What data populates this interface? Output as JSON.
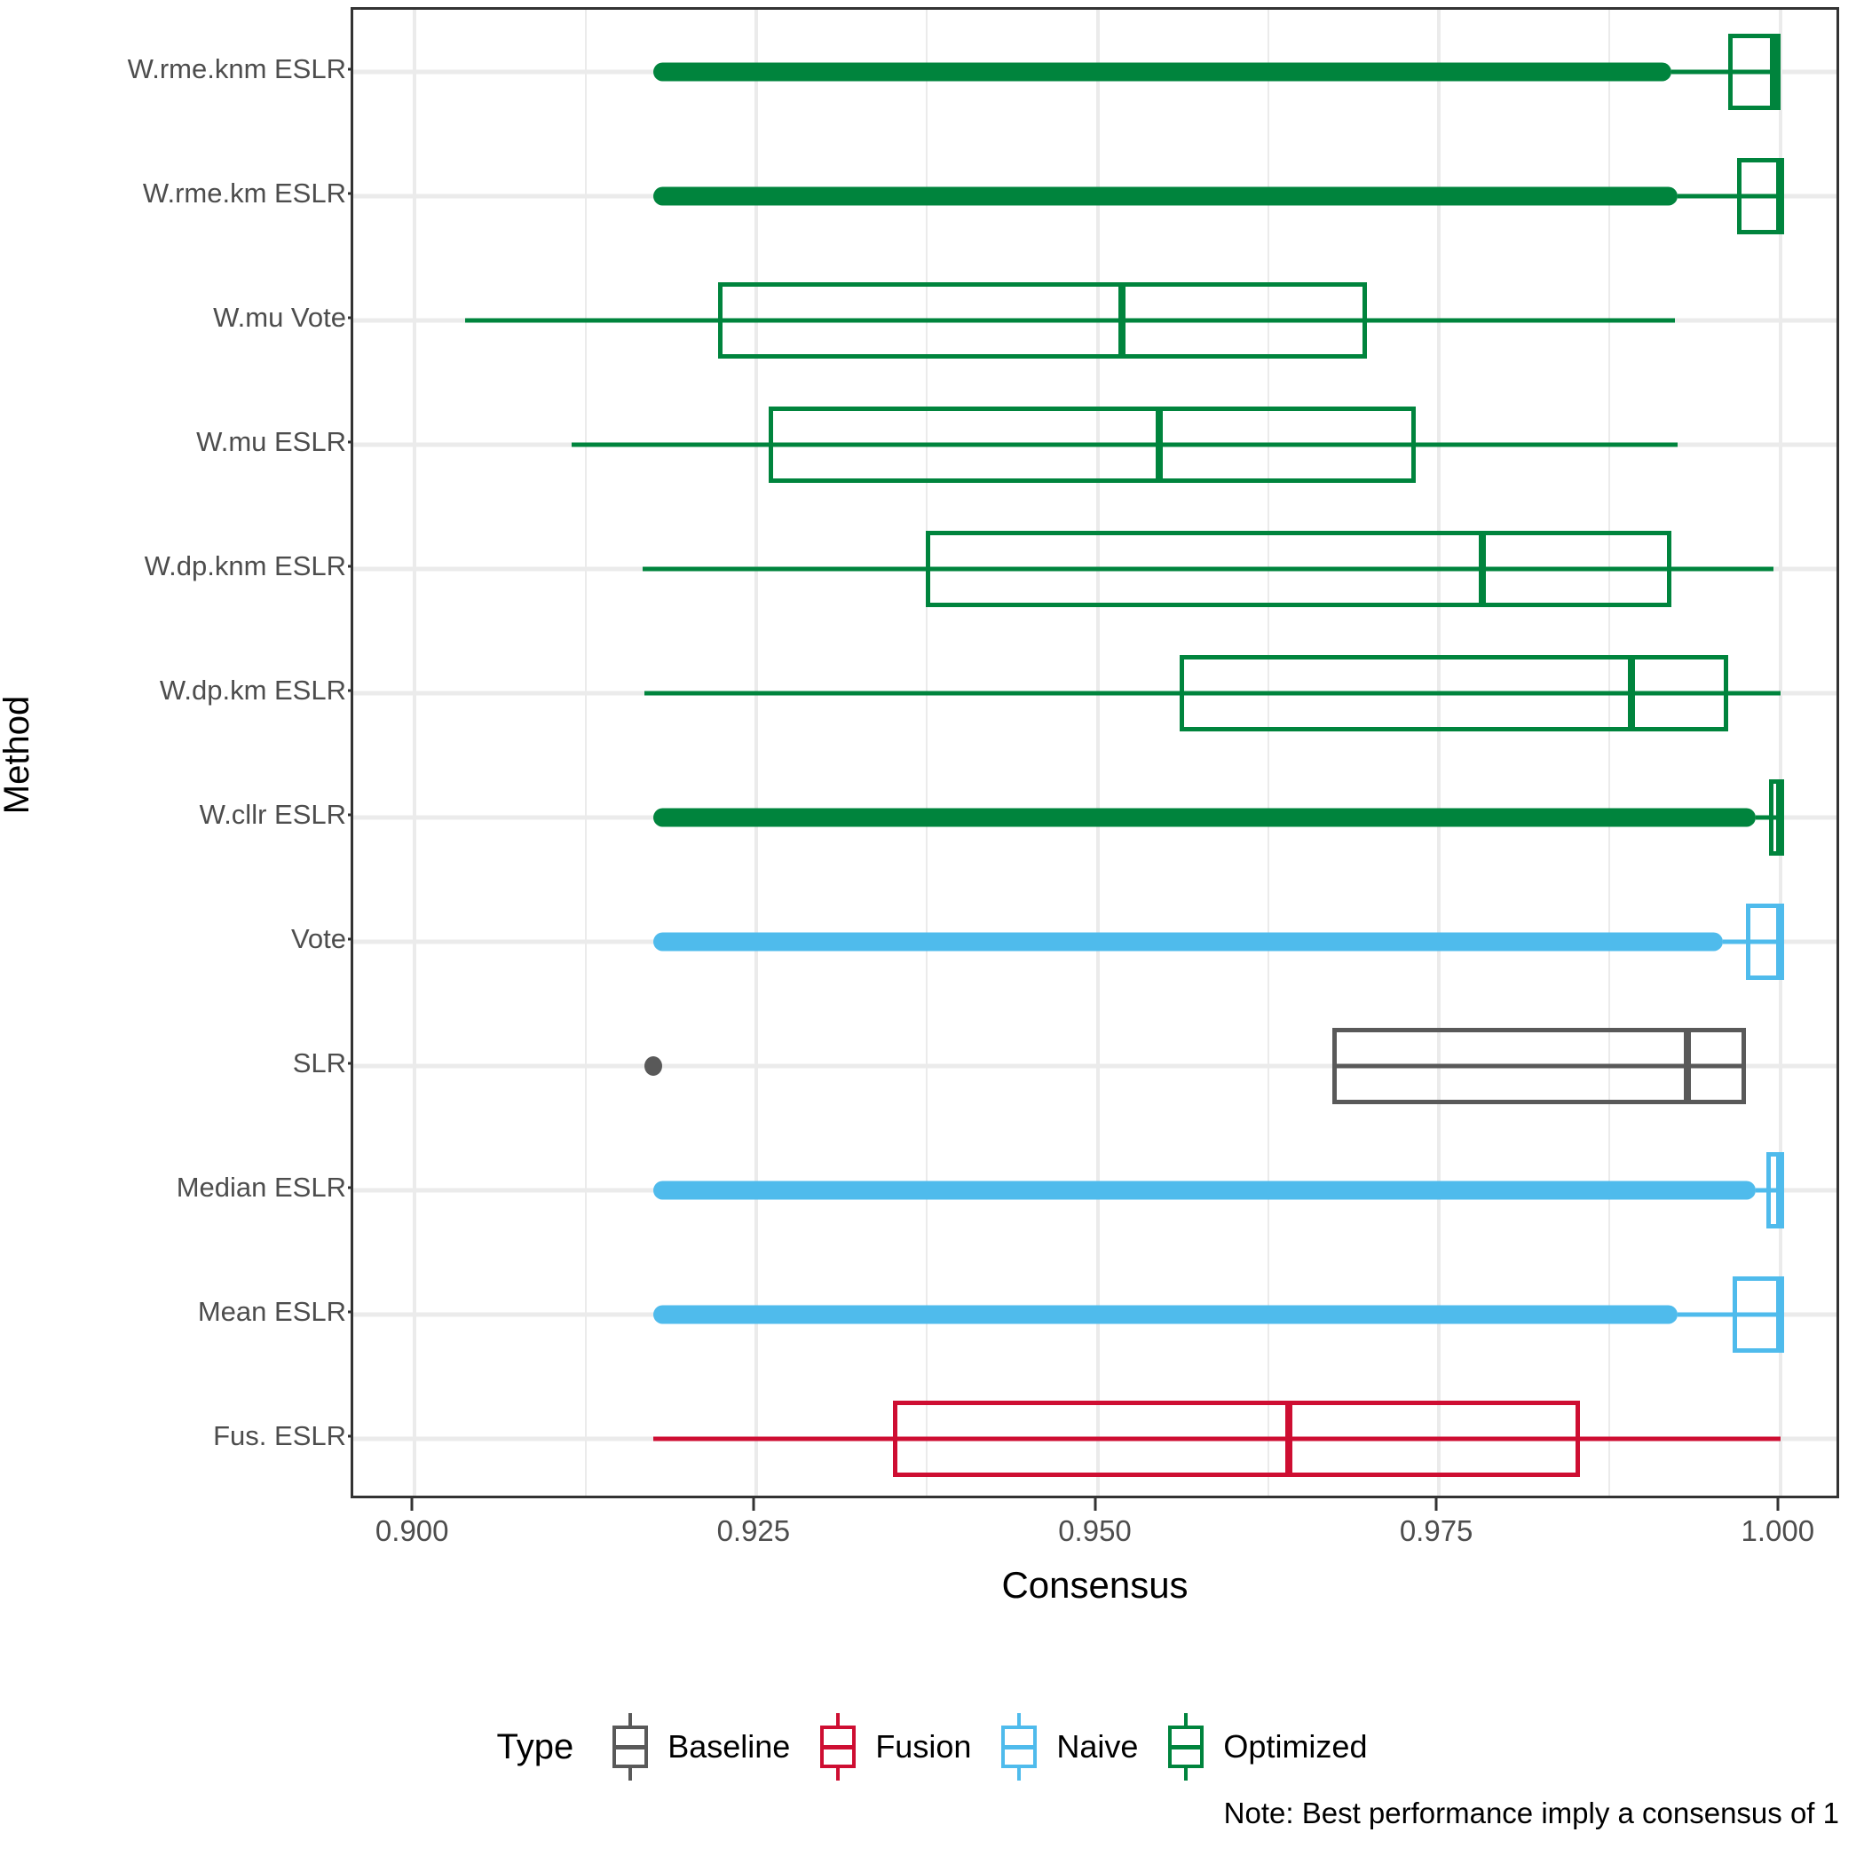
{
  "chart_data": {
    "type": "box",
    "orientation": "horizontal",
    "title": "",
    "xlabel": "Consensus",
    "ylabel": "Method",
    "xlim": [
      0.8955,
      1.0045
    ],
    "xticks": [
      0.9,
      0.925,
      0.95,
      0.975,
      1.0
    ],
    "xtick_labels": [
      "0.900",
      "0.925",
      "0.950",
      "0.975",
      "1.000"
    ],
    "x_minor_ticks": [
      0.9125,
      0.9375,
      0.9625,
      0.9875
    ],
    "grid": true,
    "legend_position": "bottom",
    "legend_title": "Type",
    "note": "Note: Best performance imply a consensus of 1",
    "categories": [
      "W.rme.knm ESLR",
      "W.rme.km ESLR",
      "W.mu Vote",
      "W.mu ESLR",
      "W.dp.knm ESLR",
      "W.dp.km ESLR",
      "W.cllr ESLR",
      "Vote",
      "SLR",
      "Median ESLR",
      "Mean ESLR",
      "Fus. ESLR"
    ],
    "types": {
      "Baseline": "#595959",
      "Fusion": "#CE0E32",
      "Naive": "#4FBBEC",
      "Optimized": "#00843D"
    },
    "boxes": [
      {
        "label": "W.rme.knm ESLR",
        "type": "Optimized",
        "color": "#00843D",
        "lower_whisker": 0.992,
        "q1": 0.9962,
        "median": 0.9995,
        "q3": 1.0,
        "upper_whisker": 1.0,
        "outliers_range": [
          0.9175,
          0.992
        ],
        "outlier_dense": true
      },
      {
        "label": "W.rme.km ESLR",
        "type": "Optimized",
        "color": "#00843D",
        "lower_whisker": 0.9925,
        "q1": 0.9968,
        "median": 1.0,
        "q3": 1.0,
        "upper_whisker": 1.0,
        "outliers_range": [
          0.9175,
          0.9925
        ],
        "outlier_dense": true
      },
      {
        "label": "W.mu Vote",
        "type": "Optimized",
        "color": "#00843D",
        "lower_whisker": 0.9037,
        "q1": 0.9222,
        "median": 0.9518,
        "q3": 0.9697,
        "upper_whisker": 0.9923,
        "outliers_range": null,
        "outlier_dense": false
      },
      {
        "label": "W.mu ESLR",
        "type": "Optimized",
        "color": "#00843D",
        "lower_whisker": 0.9115,
        "q1": 0.9259,
        "median": 0.9545,
        "q3": 0.9733,
        "upper_whisker": 0.9925,
        "outliers_range": null,
        "outlier_dense": false
      },
      {
        "label": "W.dp.knm ESLR",
        "type": "Optimized",
        "color": "#00843D",
        "lower_whisker": 0.9167,
        "q1": 0.9374,
        "median": 0.9782,
        "q3": 0.992,
        "upper_whisker": 0.9995,
        "outliers_range": null,
        "outlier_dense": false
      },
      {
        "label": "W.dp.km ESLR",
        "type": "Optimized",
        "color": "#00843D",
        "lower_whisker": 0.9168,
        "q1": 0.956,
        "median": 0.9891,
        "q3": 0.9962,
        "upper_whisker": 1.0,
        "outliers_range": null,
        "outlier_dense": false
      },
      {
        "label": "W.cllr ESLR",
        "type": "Optimized",
        "color": "#00843D",
        "lower_whisker": 0.9982,
        "q1": 0.9992,
        "median": 1.0,
        "q3": 1.0,
        "upper_whisker": 1.0,
        "outliers_range": [
          0.9175,
          0.9982
        ],
        "outlier_dense": true
      },
      {
        "label": "Vote",
        "type": "Naive",
        "color": "#4FBBEC",
        "lower_whisker": 0.9958,
        "q1": 0.9975,
        "median": 1.0,
        "q3": 1.0,
        "upper_whisker": 1.0,
        "outliers_range": [
          0.9175,
          0.9958
        ],
        "outlier_dense": true
      },
      {
        "label": "SLR",
        "type": "Baseline",
        "color": "#595959",
        "lower_whisker": 0.9672,
        "q1": 0.9672,
        "median": 0.9932,
        "q3": 0.9975,
        "upper_whisker": 0.9975,
        "outliers_range": null,
        "outlier_dense": false,
        "outlier_points": [
          0.9175
        ]
      },
      {
        "label": "Median ESLR",
        "type": "Naive",
        "color": "#4FBBEC",
        "lower_whisker": 0.9982,
        "q1": 0.999,
        "median": 1.0,
        "q3": 1.0,
        "upper_whisker": 1.0,
        "outliers_range": [
          0.9175,
          0.9982
        ],
        "outlier_dense": true
      },
      {
        "label": "Mean ESLR",
        "type": "Naive",
        "color": "#4FBBEC",
        "lower_whisker": 0.9925,
        "q1": 0.9965,
        "median": 1.0,
        "q3": 1.0,
        "upper_whisker": 1.0,
        "outliers_range": [
          0.9175,
          0.9925
        ],
        "outlier_dense": true
      },
      {
        "label": "Fus. ESLR",
        "type": "Fusion",
        "color": "#CE0E32",
        "lower_whisker": 0.9175,
        "q1": 0.935,
        "median": 0.964,
        "q3": 0.9853,
        "upper_whisker": 1.0,
        "outliers_range": null,
        "outlier_dense": false
      }
    ]
  },
  "axes": {
    "y_title": "Method",
    "x_title": "Consensus"
  },
  "legend": {
    "title": "Type",
    "entries": [
      {
        "label": "Baseline",
        "color": "#595959"
      },
      {
        "label": "Fusion",
        "color": "#CE0E32"
      },
      {
        "label": "Naive",
        "color": "#4FBBEC"
      },
      {
        "label": "Optimized",
        "color": "#00843D"
      }
    ]
  },
  "note": "Note: Best performance imply a consensus of 1"
}
